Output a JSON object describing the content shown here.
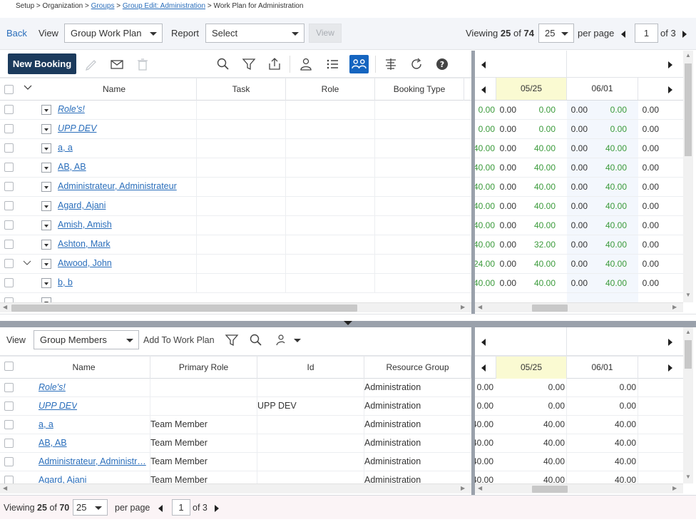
{
  "breadcrumb": {
    "setup": "Setup",
    "sep": ">",
    "organization": "Organization",
    "groups": "Groups",
    "group_edit": "Group Edit: Administration",
    "current": "Work Plan for Administration"
  },
  "topbar": {
    "back": "Back",
    "view_label": "View",
    "view_value": "Group Work Plan",
    "report_label": "Report",
    "report_value": "Select",
    "view_button": "View",
    "viewing_prefix": "Viewing",
    "viewing_count": "25",
    "viewing_of": "of",
    "viewing_total": "74",
    "page_size": "25",
    "per_page": "per page",
    "page": "1",
    "of_pages": "of 3"
  },
  "toolbar": {
    "new_booking": "New Booking"
  },
  "top_grid": {
    "columns": [
      "Name",
      "Task",
      "Role",
      "Booking Type"
    ],
    "periods": [
      "05/25",
      "06/01"
    ],
    "rows": [
      {
        "name": "Role's!",
        "italic": true,
        "values": [
          "0.00",
          "0.00",
          "0.00",
          "0.00",
          "0.00",
          "0.00"
        ],
        "colors": [
          "g",
          "dk",
          "g",
          "dk",
          "g",
          "dk"
        ]
      },
      {
        "name": "UPP DEV",
        "italic": true,
        "values": [
          "0.00",
          "0.00",
          "0.00",
          "0.00",
          "0.00",
          "0.00"
        ],
        "colors": [
          "g",
          "dk",
          "g",
          "dk",
          "g",
          "dk"
        ]
      },
      {
        "name": "a, a",
        "italic": false,
        "values": [
          "40.00",
          "0.00",
          "40.00",
          "0.00",
          "40.00",
          "0.00"
        ],
        "colors": [
          "g",
          "dk",
          "g",
          "dk",
          "g",
          "dk"
        ]
      },
      {
        "name": "AB, AB",
        "italic": false,
        "values": [
          "40.00",
          "0.00",
          "40.00",
          "0.00",
          "40.00",
          "0.00"
        ],
        "colors": [
          "g",
          "dk",
          "g",
          "dk",
          "g",
          "dk"
        ]
      },
      {
        "name": "Administrateur, Administrateur",
        "italic": false,
        "values": [
          "40.00",
          "0.00",
          "40.00",
          "0.00",
          "40.00",
          "0.00"
        ],
        "colors": [
          "g",
          "dk",
          "g",
          "dk",
          "g",
          "dk"
        ]
      },
      {
        "name": "Agard, Ajani",
        "italic": false,
        "values": [
          "40.00",
          "0.00",
          "40.00",
          "0.00",
          "40.00",
          "0.00"
        ],
        "colors": [
          "g",
          "dk",
          "g",
          "dk",
          "g",
          "dk"
        ]
      },
      {
        "name": "Amish, Amish",
        "italic": false,
        "values": [
          "40.00",
          "0.00",
          "40.00",
          "0.00",
          "40.00",
          "0.00"
        ],
        "colors": [
          "g",
          "dk",
          "g",
          "dk",
          "g",
          "dk"
        ]
      },
      {
        "name": "Ashton, Mark",
        "italic": false,
        "values": [
          "40.00",
          "0.00",
          "32.00",
          "0.00",
          "40.00",
          "0.00"
        ],
        "colors": [
          "g",
          "dk",
          "g",
          "dk",
          "g",
          "dk"
        ]
      },
      {
        "name": "Atwood, John",
        "italic": false,
        "expanded": true,
        "values": [
          "24.00",
          "0.00",
          "40.00",
          "0.00",
          "40.00",
          "0.00"
        ],
        "colors": [
          "g",
          "dk",
          "g",
          "dk",
          "g",
          "dk"
        ]
      },
      {
        "name": "b, b",
        "italic": false,
        "values": [
          "40.00",
          "0.00",
          "40.00",
          "0.00",
          "40.00",
          "0.00"
        ],
        "colors": [
          "g",
          "dk",
          "g",
          "dk",
          "g",
          "dk"
        ]
      }
    ]
  },
  "bottom_bar": {
    "view_label": "View",
    "view_value": "Group Members",
    "add_to_work_plan": "Add To Work Plan"
  },
  "bottom_grid": {
    "columns": [
      "Name",
      "Primary Role",
      "Id",
      "Resource Group"
    ],
    "periods": [
      "05/25",
      "06/01"
    ],
    "rows": [
      {
        "name": "Role's!",
        "italic": true,
        "role": "",
        "id": "",
        "group": "Administration",
        "values": [
          "0.00",
          "0.00",
          "0.00"
        ]
      },
      {
        "name": "UPP DEV",
        "italic": true,
        "role": "",
        "id": "UPP DEV",
        "group": "Administration",
        "values": [
          "0.00",
          "0.00",
          "0.00"
        ]
      },
      {
        "name": "a, a",
        "italic": false,
        "role": "Team Member",
        "id": "",
        "group": "Administration",
        "values": [
          "40.00",
          "40.00",
          "40.00"
        ]
      },
      {
        "name": "AB, AB",
        "italic": false,
        "role": "Team Member",
        "id": "",
        "group": "Administration",
        "values": [
          "40.00",
          "40.00",
          "40.00"
        ]
      },
      {
        "name": "Administrateur, Administr…",
        "italic": false,
        "role": "Team Member",
        "id": "",
        "group": "Administration",
        "values": [
          "40.00",
          "40.00",
          "40.00"
        ]
      },
      {
        "name": "Agard, Ajani",
        "italic": false,
        "role": "Team Member",
        "id": "",
        "group": "Administration",
        "values": [
          "40.00",
          "40.00",
          "40.00"
        ]
      }
    ]
  },
  "footer": {
    "viewing_prefix": "Viewing",
    "viewing_count": "25",
    "viewing_of": "of",
    "viewing_total": "70",
    "page_size": "25",
    "per_page": "per page",
    "page": "1",
    "of_pages": "of 3"
  }
}
